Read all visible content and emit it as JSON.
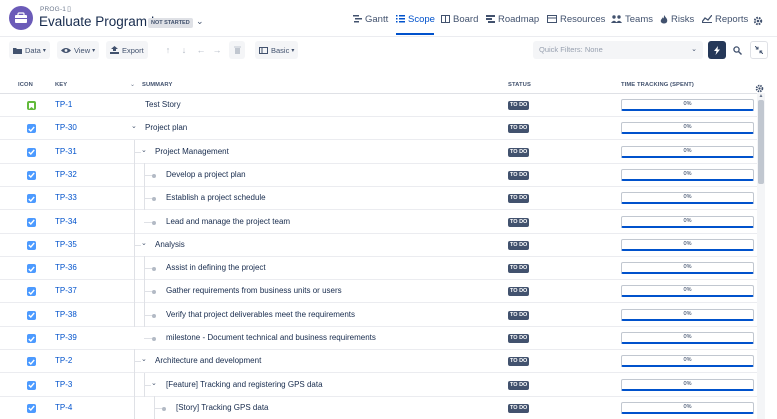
{
  "header": {
    "program_id": "PROG-1",
    "title": "Evaluate Program I",
    "status": "NOT STARTED"
  },
  "nav": {
    "gantt": "Gantt",
    "scope": "Scope",
    "board": "Board",
    "roadmap": "Roadmap",
    "resources": "Resources",
    "teams": "Teams",
    "risks": "Risks",
    "reports": "Reports",
    "active": "Scope"
  },
  "toolbar": {
    "data": "Data",
    "view": "View",
    "export": "Export",
    "basic": "Basic",
    "quick_filters_placeholder": "Quick Filters: None"
  },
  "columns": {
    "icon": "ICON",
    "key": "KEY",
    "summary": "SUMMARY",
    "status": "STATUS",
    "time_tracking": "TIME TRACKING (SPENT)"
  },
  "rows": [
    {
      "key": "TP-1",
      "summary": "Test Story",
      "status": "TO DO",
      "progress": "0%",
      "type": "story"
    },
    {
      "key": "TP-30",
      "summary": "Project plan",
      "status": "TO DO",
      "progress": "0%",
      "type": "task"
    },
    {
      "key": "TP-31",
      "summary": "Project Management",
      "status": "TO DO",
      "progress": "0%",
      "type": "task"
    },
    {
      "key": "TP-32",
      "summary": "Develop a project plan",
      "status": "TO DO",
      "progress": "0%",
      "type": "task"
    },
    {
      "key": "TP-33",
      "summary": "Establish a project schedule",
      "status": "TO DO",
      "progress": "0%",
      "type": "task"
    },
    {
      "key": "TP-34",
      "summary": "Lead and manage the project team",
      "status": "TO DO",
      "progress": "0%",
      "type": "task"
    },
    {
      "key": "TP-35",
      "summary": "Analysis",
      "status": "TO DO",
      "progress": "0%",
      "type": "task"
    },
    {
      "key": "TP-36",
      "summary": "Assist in defining the project",
      "status": "TO DO",
      "progress": "0%",
      "type": "task"
    },
    {
      "key": "TP-37",
      "summary": "Gather requirements from business units or users",
      "status": "TO DO",
      "progress": "0%",
      "type": "task"
    },
    {
      "key": "TP-38",
      "summary": "Verify that project deliverables meet the requirements",
      "status": "TO DO",
      "progress": "0%",
      "type": "task"
    },
    {
      "key": "TP-39",
      "summary": "milestone - Document technical and business requirements",
      "status": "TO DO",
      "progress": "0%",
      "type": "task"
    },
    {
      "key": "TP-2",
      "summary": "Architecture and development",
      "status": "TO DO",
      "progress": "0%",
      "type": "task"
    },
    {
      "key": "TP-3",
      "summary": "[Feature] Tracking and registering GPS data",
      "status": "TO DO",
      "progress": "0%",
      "type": "task"
    },
    {
      "key": "TP-4",
      "summary": "[Story] Tracking GPS data",
      "status": "TO DO",
      "progress": "0%",
      "type": "task"
    }
  ]
}
